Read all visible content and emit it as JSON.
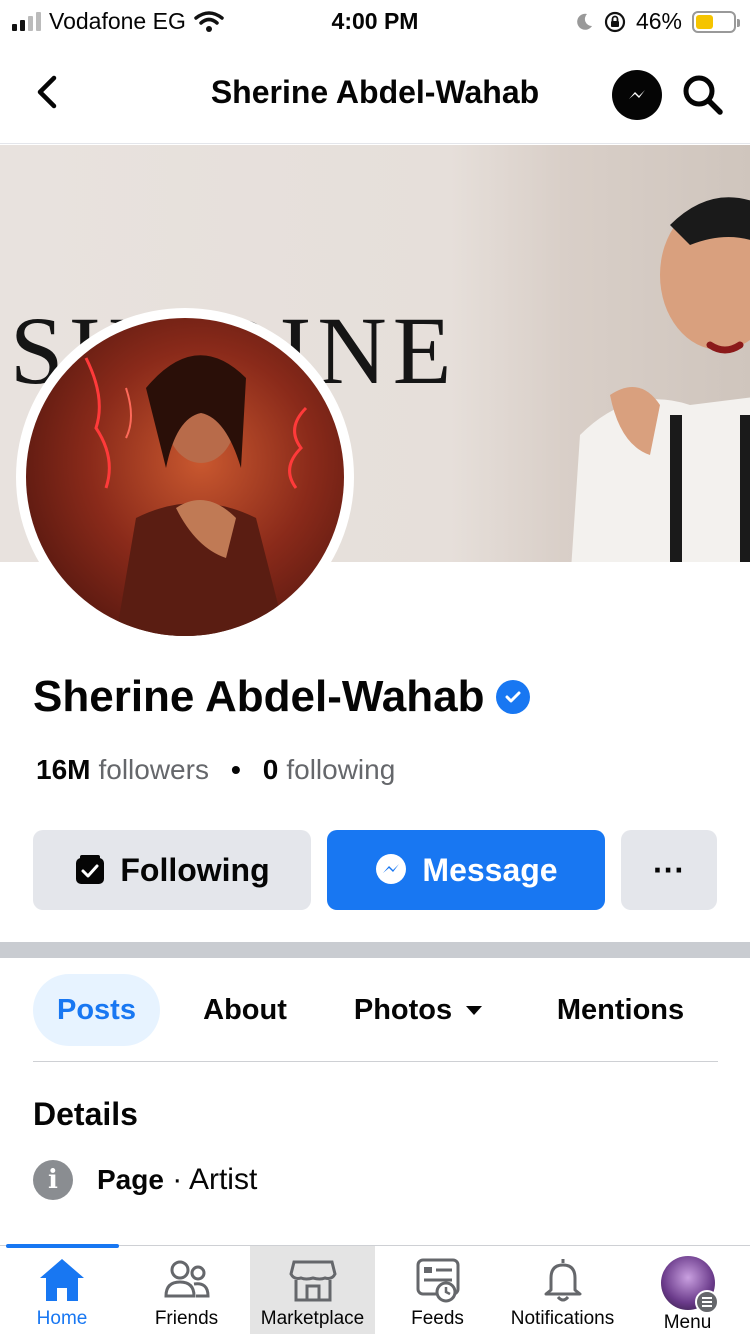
{
  "status_bar": {
    "carrier": "Vodafone EG",
    "time": "4:00 PM",
    "battery": "46%",
    "battery_level": 0.46
  },
  "header": {
    "title": "Sherine Abdel-Wahab",
    "back_icon": "chevron-left-icon",
    "messenger_icon": "messenger-icon",
    "search_icon": "search-icon"
  },
  "cover": {
    "text": "SHERINE"
  },
  "profile": {
    "name": "Sherine Abdel-Wahab",
    "verified": true,
    "followers_count": "16M",
    "followers_label": "followers",
    "following_count": "0",
    "following_label": "following"
  },
  "actions": {
    "following_label": "Following",
    "message_label": "Message",
    "more_label": "···"
  },
  "tabs": [
    {
      "label": "Posts",
      "active": true
    },
    {
      "label": "About",
      "active": false
    },
    {
      "label": "Photos",
      "active": false
    },
    {
      "label": "Mentions",
      "active": false
    }
  ],
  "details": {
    "title": "Details",
    "page_label": "Page",
    "separator": "·",
    "category": "Artist"
  },
  "tabbar": {
    "items": [
      {
        "label": "Home",
        "icon": "home-icon",
        "active": true
      },
      {
        "label": "Friends",
        "icon": "friends-icon",
        "active": false
      },
      {
        "label": "Marketplace",
        "icon": "marketplace-icon",
        "active": false
      },
      {
        "label": "Feeds",
        "icon": "feeds-icon",
        "active": false
      },
      {
        "label": "Notifications",
        "icon": "bell-icon",
        "active": false
      },
      {
        "label": "Menu",
        "icon": "menu-avatar",
        "active": false
      }
    ]
  },
  "colors": {
    "accent": "#1877f2",
    "button_gray": "#e4e6eb",
    "text_secondary": "#65676b"
  }
}
